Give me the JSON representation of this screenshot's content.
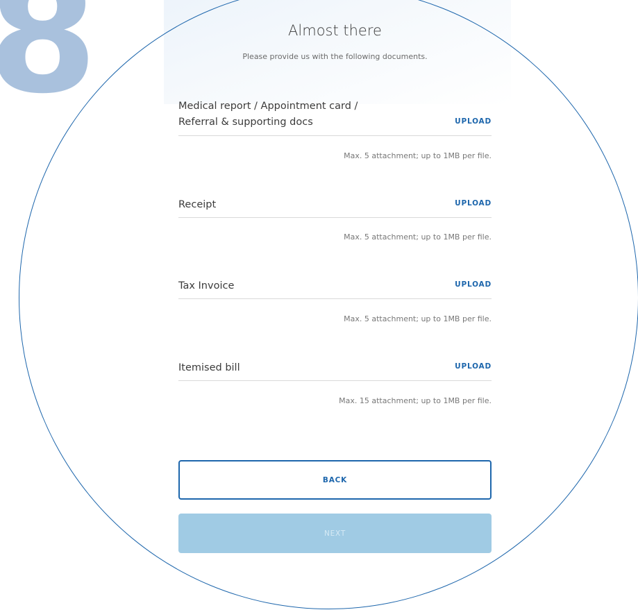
{
  "step": {
    "number": "8"
  },
  "header": {
    "title": "Almost there",
    "subtitle": "Please provide us with the following documents."
  },
  "documents": [
    {
      "label_line1": "Medical report / Appointment card /",
      "label_line2": "Referral & supporting docs",
      "action": "UPLOAD",
      "hint": "Max. 5 attachment; up to 1MB per file."
    },
    {
      "label_line1": "Receipt",
      "action": "UPLOAD",
      "hint": "Max. 5 attachment; up to 1MB per file."
    },
    {
      "label_line1": "Tax Invoice",
      "action": "UPLOAD",
      "hint": "Max. 5 attachment; up to 1MB per file."
    },
    {
      "label_line1": "Itemised bill",
      "action": "UPLOAD",
      "hint": "Max. 15 attachment; up to 1MB per file."
    }
  ],
  "buttons": {
    "back": "BACK",
    "next": "NEXT"
  },
  "colors": {
    "accent": "#1d66ac",
    "step_number": "#a9c1dd",
    "next_disabled": "#a0cbe4"
  }
}
